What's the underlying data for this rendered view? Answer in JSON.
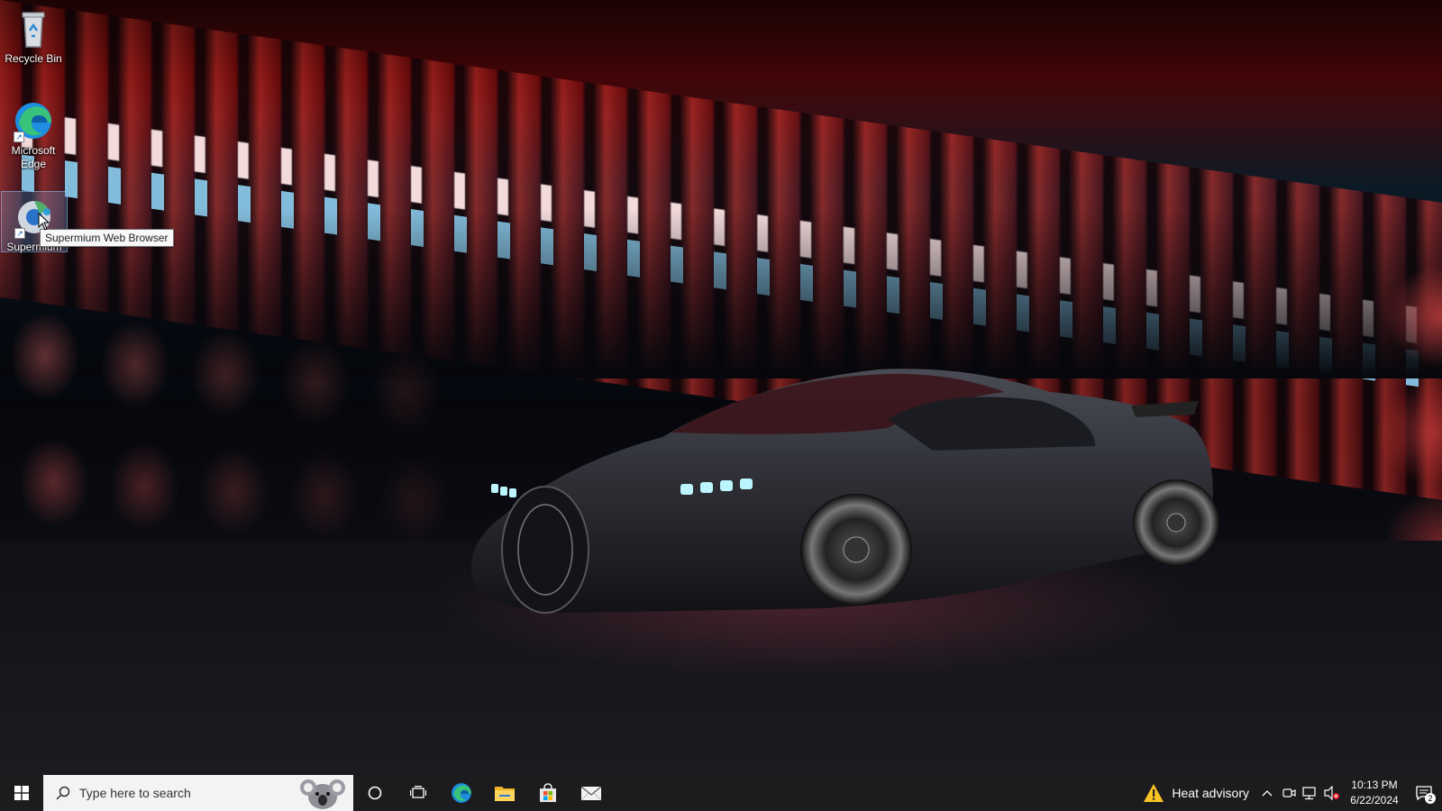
{
  "desktop": {
    "icons": [
      {
        "label": "Recycle Bin",
        "icon": "recycle-bin-icon"
      },
      {
        "label": "Microsoft Edge",
        "icon": "edge-icon"
      },
      {
        "label": "Supermium",
        "icon": "supermium-icon"
      }
    ],
    "tooltip": "Supermium Web Browser"
  },
  "taskbar": {
    "start_icon": "windows-logo-icon",
    "search": {
      "placeholder": "Type here to search"
    },
    "pinned": [
      {
        "name": "Cortana",
        "icon": "cortana-circle-icon"
      },
      {
        "name": "Task View",
        "icon": "task-view-icon"
      },
      {
        "name": "Microsoft Edge",
        "icon": "edge-icon"
      },
      {
        "name": "File Explorer",
        "icon": "folder-icon"
      },
      {
        "name": "Microsoft Store",
        "icon": "store-bag-icon"
      },
      {
        "name": "Mail",
        "icon": "mail-icon"
      }
    ],
    "weather": {
      "text": "Heat advisory",
      "icon": "warning-icon"
    },
    "tray_icons": [
      "chevron-up-icon",
      "meet-now-icon",
      "network-icon",
      "volume-muted-icon"
    ],
    "clock": {
      "time": "10:13 PM",
      "date": "6/22/2024"
    },
    "notifications": {
      "count": "2"
    }
  }
}
